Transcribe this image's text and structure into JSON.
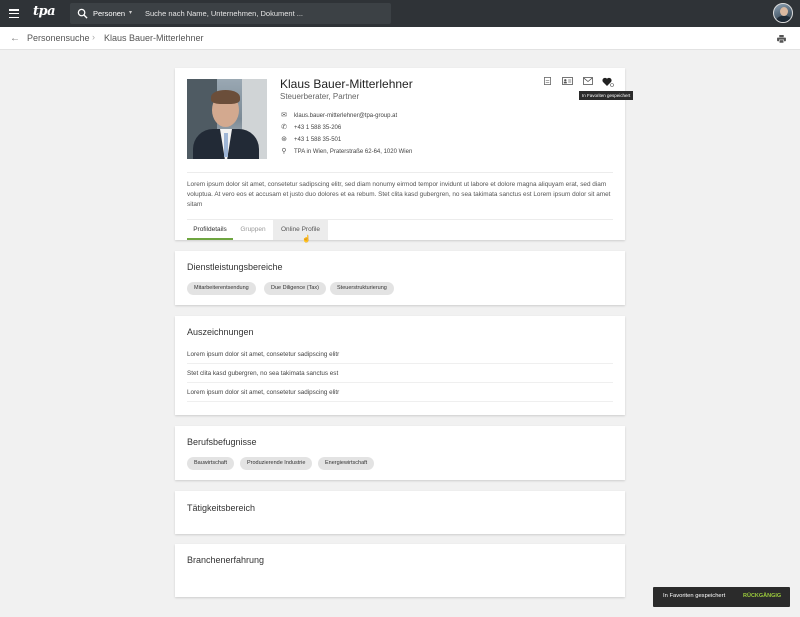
{
  "header": {
    "logo_text": "tpa",
    "search": {
      "scope": "Personen",
      "placeholder": "Suche nach Name, Unternehmen, Dokument ..."
    }
  },
  "breadcrumb": {
    "parent": "Personensuche",
    "current": "Klaus Bauer-Mitterlehner"
  },
  "profile": {
    "name": "Klaus Bauer-Mitterlehner",
    "role": "Steuerberater, Partner",
    "contacts": [
      {
        "icon": "mail-icon",
        "text": "klaus.bauer-mitterlehner@tpa-group.at"
      },
      {
        "icon": "phone-icon",
        "text": "+43 1 588 35-206"
      },
      {
        "icon": "fax-icon",
        "text": "+43 1 588 35-501"
      },
      {
        "icon": "location-pin-icon",
        "text": "TPA in Wien, Praterstraße 62-64, 1020 Wien"
      }
    ],
    "description": "Lorem ipsum dolor sit amet, consetetur sadipscing elitr, sed diam nonumy eirmod tempor invidunt ut labore et dolore magna aliquyam erat, sed diam voluptua. At vero eos et accusam et justo duo dolores et ea rebum. Stet clita kasd gubergren, no sea takimata sanctus est Lorem ipsum dolor sit amet sitam",
    "tooltip": "In Favoriten gespeichert",
    "tabs": [
      "Profildetails",
      "Gruppen",
      "Online Profile"
    ],
    "active_tab": "Profildetails"
  },
  "sections": {
    "services": {
      "title": "Dienstleistungsbereiche",
      "chips": [
        "Mitarbeiterentsendung",
        "Due Diligence (Tax)",
        "Steuerstrukturierung"
      ]
    },
    "awards": {
      "title": "Auszeichnungen",
      "items": [
        "Lorem ipsum dolor sit amet, consetetur sadipscing elitr",
        "Stet clita kasd gubergren, no sea takimata sanctus est",
        "Lorem ipsum dolor sit amet, consetetur sadipscing elitr"
      ]
    },
    "qualifications": {
      "title": "Berufsbefugnisse",
      "chips": [
        "Bauwirtschaft",
        "Produzierende Industrie",
        "Energiewirtschaft"
      ]
    },
    "activity": {
      "title": "Tätigkeitsbereich"
    },
    "industry": {
      "title": "Branchenerfahrung"
    }
  },
  "snackbar": {
    "message": "In Favoriten gespeichert",
    "action": "RÜCKGÄNGIG"
  },
  "colors": {
    "topbar": "#2f3337",
    "accent_tab": "#6ea540",
    "snackbar_action": "#9ccc3c"
  }
}
